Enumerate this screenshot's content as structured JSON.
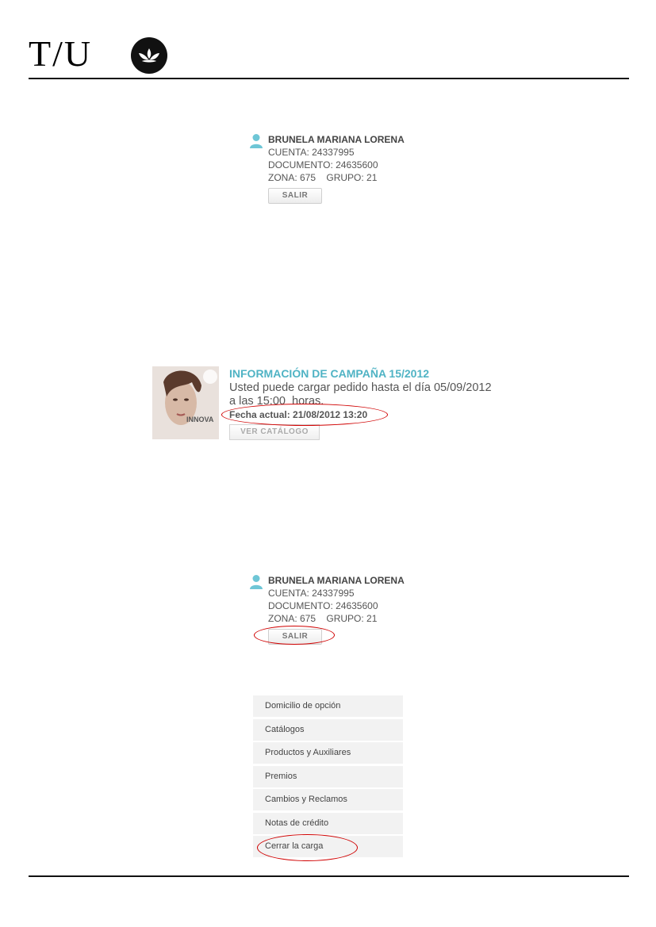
{
  "header": {
    "logo_text": "T/U"
  },
  "user_block_top": {
    "name": "BRUNELA MARIANA LORENA",
    "account": "CUENTA: 24337995",
    "document": "DOCUMENTO: 24635600",
    "zone_group": "ZONA: 675    GRUPO: 21",
    "logout_label": "SALIR"
  },
  "campaign": {
    "title": "INFORMACIÓN DE CAMPAÑA 15/2012",
    "text_line1": "Usted puede cargar pedido hasta el día 05/09/2012",
    "text_line2": "a las 15:00  horas.",
    "current_date": "Fecha actual: 21/08/2012 13:20",
    "catalog_button": "VER CATÁLOGO",
    "catalog_image_text": "INNOVA"
  },
  "user_block_bottom": {
    "name": "BRUNELA MARIANA LORENA",
    "account": "CUENTA: 24337995",
    "document": "DOCUMENTO: 24635600",
    "zone_group": "ZONA: 675    GRUPO: 21",
    "logout_label": "SALIR"
  },
  "menu": {
    "items": [
      "Domicilio de opción",
      "Catálogos",
      "Productos y Auxiliares",
      "Premios",
      "Cambios y Reclamos",
      "Notas de crédito",
      "Cerrar la carga"
    ]
  },
  "colors": {
    "accent": "#4fb3c4",
    "annotation": "#d00000"
  },
  "icons": [
    "user-icon",
    "lotus-emblem-icon"
  ]
}
